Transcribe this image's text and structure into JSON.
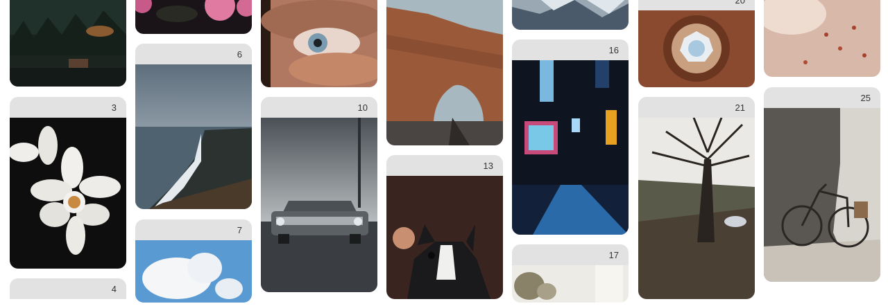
{
  "gallery": {
    "cards": {
      "forest_cabin": {
        "number": ""
      },
      "roses": {
        "number": ""
      },
      "eye_closeup": {
        "number": ""
      },
      "rock_arch": {
        "number": ""
      },
      "ice_stream": {
        "number": ""
      },
      "ceiling_dome": {
        "number": "20"
      },
      "dry_flowers": {
        "number": ""
      },
      "daffodil": {
        "number": "3"
      },
      "sea_cliffs": {
        "number": "6"
      },
      "vintage_car": {
        "number": "10"
      },
      "french_bulldog": {
        "number": "13"
      },
      "city_night": {
        "number": "16"
      },
      "bare_tree": {
        "number": "21"
      },
      "bicycle_wall": {
        "number": "25"
      },
      "sky_clouds": {
        "number": "7"
      },
      "partial_bottom_4": {
        "number": "4"
      },
      "plant_17": {
        "number": "17"
      }
    }
  }
}
